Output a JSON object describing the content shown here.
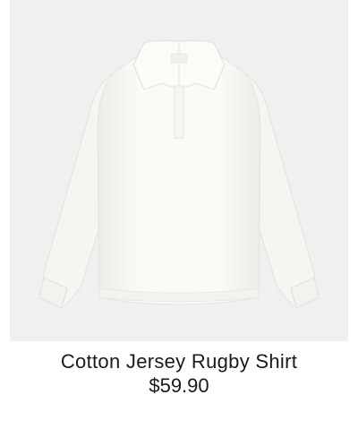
{
  "product": {
    "name": "Cotton Jersey Rugby Shirt",
    "price": "$59.90",
    "image_icon": "white-rugby-shirt-photo",
    "colors": {
      "background": "#f0f0f0",
      "garment": "#fbfaf6",
      "text": "#1a1a1a"
    }
  }
}
